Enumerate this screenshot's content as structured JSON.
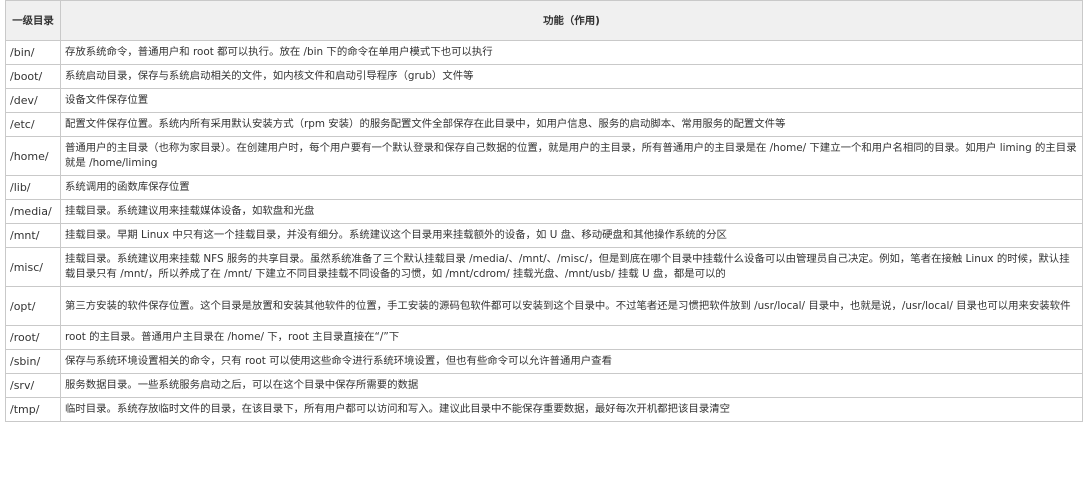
{
  "table": {
    "headers": {
      "dir": "一级目录",
      "func": "功能（作用)"
    },
    "rows": [
      {
        "dir": "/bin/",
        "func": "存放系统命令，普通用户和 root 都可以执行。放在 /bin 下的命令在单用户模式下也可以执行"
      },
      {
        "dir": "/boot/",
        "func": "系统启动目录，保存与系统启动相关的文件，如内核文件和启动引导程序（grub）文件等"
      },
      {
        "dir": "/dev/",
        "func": "设备文件保存位置"
      },
      {
        "dir": "/etc/",
        "func": "配置文件保存位置。系统内所有采用默认安装方式（rpm 安装）的服务配置文件全部保存在此目录中，如用户信息、服务的启动脚本、常用服务的配置文件等"
      },
      {
        "dir": "/home/",
        "func": "普通用户的主目录（也称为家目录）。在创建用户时，每个用户要有一个默认登录和保存自己数据的位置，就是用户的主目录，所有普通用户的主目录是在 /home/ 下建立一个和用户名相同的目录。如用户 liming 的主目录就是 /home/liming"
      },
      {
        "dir": "/lib/",
        "func": "系统调用的函数库保存位置"
      },
      {
        "dir": "/media/",
        "func": "挂载目录。系统建议用来挂载媒体设备，如软盘和光盘"
      },
      {
        "dir": "/mnt/",
        "func": "挂载目录。早期 Linux 中只有这一个挂载目录，并没有细分。系统建议这个目录用来挂载额外的设备，如 U 盘、移动硬盘和其他操作系统的分区"
      },
      {
        "dir": "/misc/",
        "func": "挂载目录。系统建议用来挂载 NFS 服务的共享目录。虽然系统准备了三个默认挂载目录 /media/、/mnt/、/misc/，但是到底在哪个目录中挂载什么设备可以由管理员自己决定。例如，笔者在接触 Linux 的时候，默认挂载目录只有 /mnt/，所以养成了在 /mnt/ 下建立不同目录挂载不同设备的习惯，如 /mnt/cdrom/ 挂载光盘、/mnt/usb/ 挂载 U 盘，都是可以的"
      },
      {
        "dir": "/opt/",
        "func": "第三方安装的软件保存位置。这个目录是放置和安装其他软件的位置，手工安装的源码包软件都可以安装到这个目录中。不过笔者还是习惯把软件放到 /usr/local/ 目录中，也就是说，/usr/local/ 目录也可以用来安装软件"
      },
      {
        "dir": "/root/",
        "func": "root 的主目录。普通用户主目录在 /home/ 下，root 主目录直接在“/”下"
      },
      {
        "dir": "/sbin/",
        "func": "保存与系统环境设置相关的命令，只有 root 可以使用这些命令进行系统环境设置，但也有些命令可以允许普通用户查看"
      },
      {
        "dir": "/srv/",
        "func": "服务数据目录。一些系统服务启动之后，可以在这个目录中保存所需要的数据"
      },
      {
        "dir": "/tmp/",
        "func": "临时目录。系统存放临时文件的目录，在该目录下，所有用户都可以访问和写入。建议此目录中不能保存重要数据，最好每次开机都把该目录清空"
      }
    ]
  }
}
